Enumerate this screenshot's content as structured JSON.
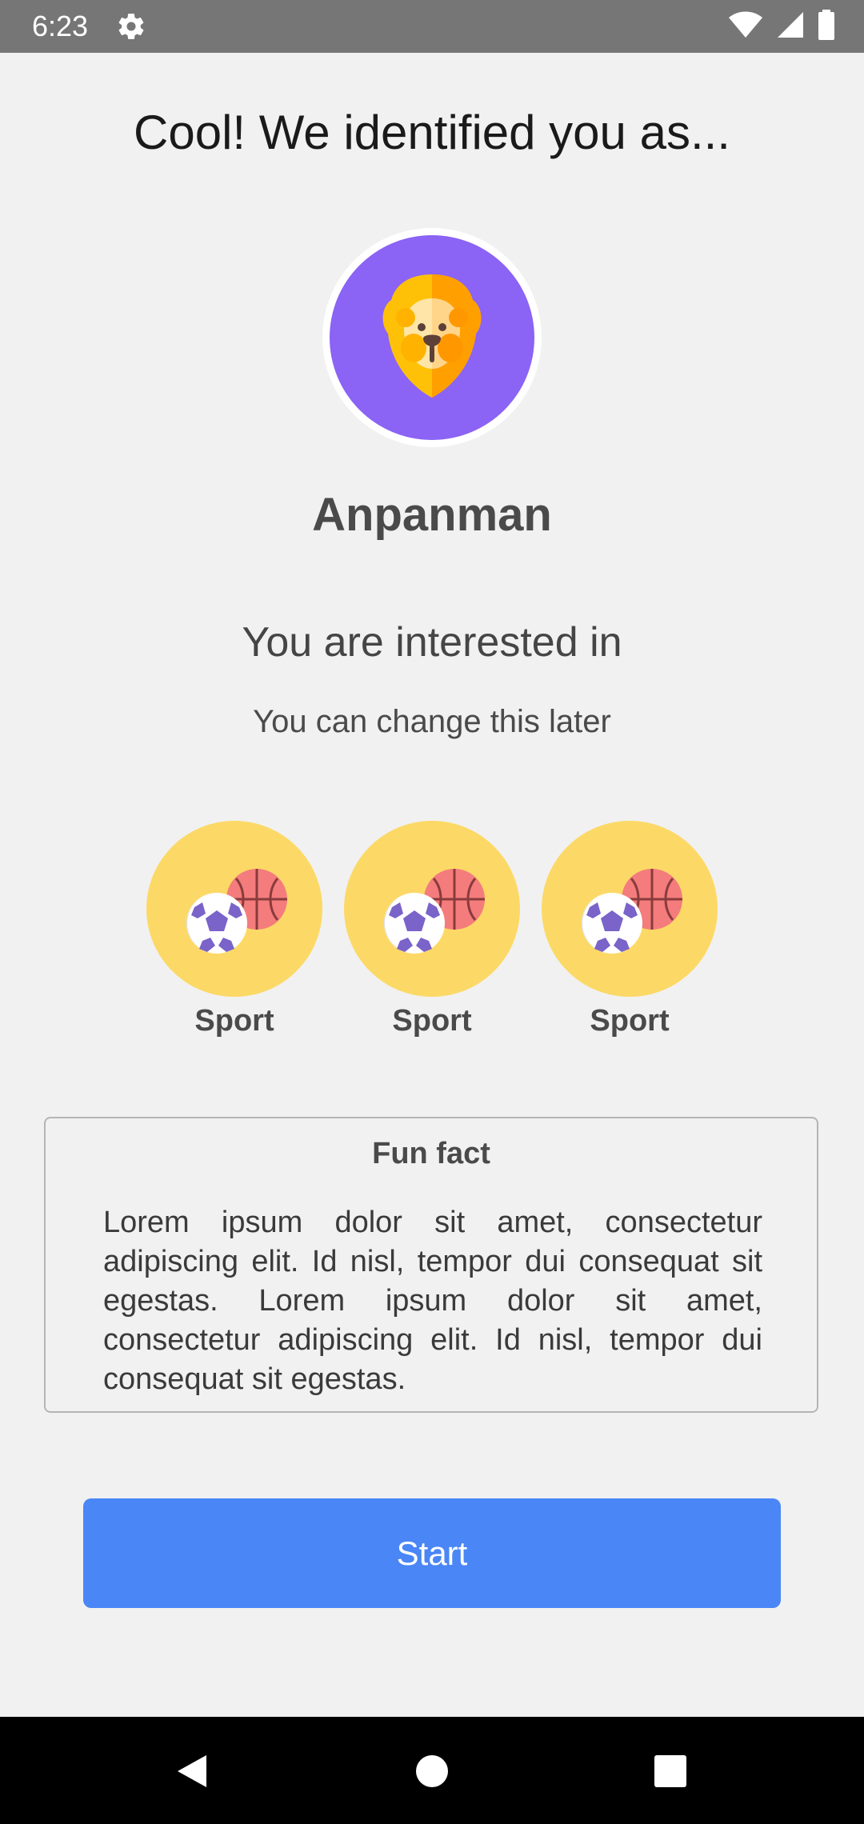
{
  "status_bar": {
    "time": "6:23",
    "icons": [
      "gear-icon",
      "wifi-icon",
      "cell-signal-icon",
      "battery-icon"
    ]
  },
  "header": {
    "title": "Cool! We identified you as..."
  },
  "profile": {
    "avatar_icon": "lion-icon",
    "avatar_color": "#8b63f5",
    "name": "Anpanman"
  },
  "interests": {
    "title": "You are interested in",
    "subtitle": "You can change this later",
    "items": [
      {
        "label": "Sport",
        "icon": "sport-balls-icon"
      },
      {
        "label": "Sport",
        "icon": "sport-balls-icon"
      },
      {
        "label": "Sport",
        "icon": "sport-balls-icon"
      }
    ],
    "circle_color": "#fcd966"
  },
  "fun_fact": {
    "title": "Fun fact",
    "body": "Lorem ipsum dolor sit amet, consectetur adipiscing elit. Id nisl, tempor dui consequat sit egestas. Lorem ipsum dolor sit amet, consectetur adipiscing elit. Id nisl, tempor dui consequat sit egestas."
  },
  "actions": {
    "start_label": "Start",
    "accent_color": "#4a86f5"
  },
  "nav_bar": {
    "buttons": [
      "back-icon",
      "home-icon",
      "recents-icon"
    ]
  }
}
